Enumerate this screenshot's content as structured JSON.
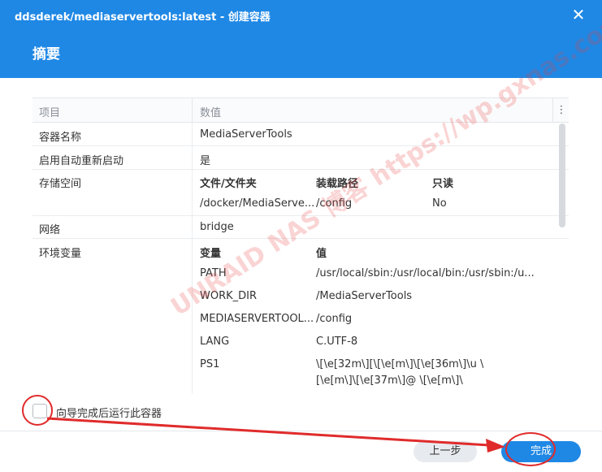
{
  "window": {
    "title": "ddsderek/mediaservertools:latest - 创建容器",
    "close_glyph": "✕"
  },
  "page": {
    "title": "摘要"
  },
  "table": {
    "headers": {
      "key": "项目",
      "value": "数值",
      "menu": "⋮"
    },
    "rows": {
      "name": {
        "key": "容器名称",
        "value": "MediaServerTools"
      },
      "autorestart": {
        "key": "启用自动重新启动",
        "value": "是"
      },
      "storage": {
        "key": "存储空间",
        "cols": [
          "文件/文件夹",
          "装载路径",
          "只读"
        ],
        "entry": [
          "/docker/MediaServe...",
          "/config",
          "No"
        ]
      },
      "network": {
        "key": "网络",
        "value": "bridge"
      },
      "env": {
        "key": "环境变量",
        "cols": [
          "变量",
          "值"
        ],
        "vars": [
          {
            "name": "PATH",
            "value": "/usr/local/sbin:/usr/local/bin:/usr/sbin:/u..."
          },
          {
            "name": "WORK_DIR",
            "value": "/MediaServerTools"
          },
          {
            "name": "MEDIASERVERTOOL...",
            "value": "/config"
          },
          {
            "name": "LANG",
            "value": "C.UTF-8"
          },
          {
            "name": "PS1",
            "value": "\\[\\e[32m\\][\\[\\e[m\\]\\[\\e[36m\\]\\u \\",
            "value2": "[\\e[m\\]\\[\\e[37m\\]@ \\[\\e[m\\]\\"
          }
        ]
      }
    }
  },
  "watermark": "UNRAID NAS 博客 https://wp.gxnas.com",
  "run_after_checkbox": {
    "label": "向导完成后运行此容器",
    "checked": false
  },
  "buttons": {
    "back": "上一步",
    "finish": "完成"
  },
  "colors": {
    "accent": "#1f88e5",
    "annotation": "#e02b2b"
  }
}
